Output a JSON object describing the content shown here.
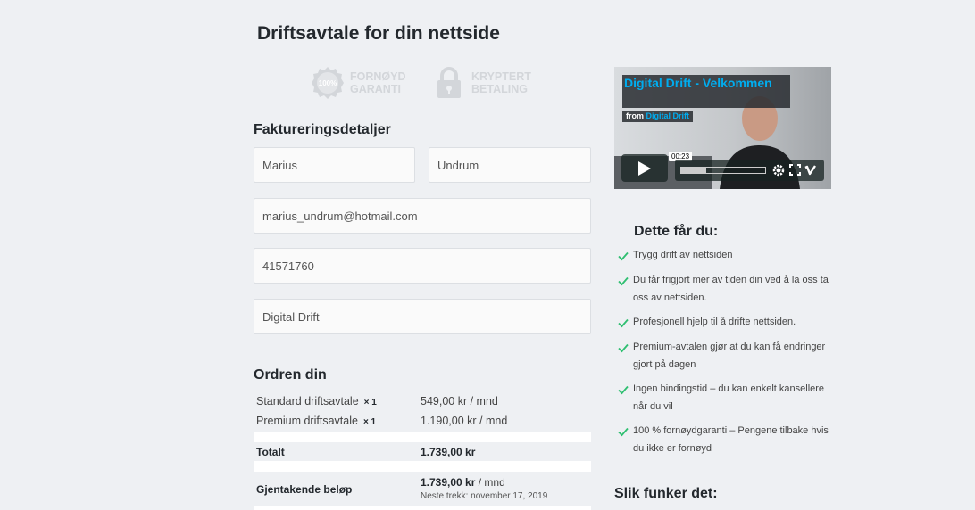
{
  "page": {
    "title": "Driftsavtale for din nettside"
  },
  "badges": [
    {
      "icon": "guarantee-seal-icon",
      "seal_text": "100%",
      "line1": "FORNØYD",
      "line2": "GARANTI"
    },
    {
      "icon": "lock-icon",
      "line1": "KRYPTERT",
      "line2": "BETALING"
    }
  ],
  "billing": {
    "heading": "Faktureringsdetaljer",
    "first_name": "Marius",
    "last_name": "Undrum",
    "email": "marius_undrum@hotmail.com",
    "phone": "41571760",
    "company": "Digital Drift"
  },
  "order": {
    "heading": "Ordren din",
    "items": [
      {
        "name": "Standard driftsavtale",
        "qty": "× 1",
        "price": "549,00 kr / mnd"
      },
      {
        "name": "Premium driftsavtale",
        "qty": "× 1",
        "price": "1.190,00 kr / mnd"
      }
    ],
    "total_label": "Totalt",
    "total_value": "1.739,00 kr",
    "recurring_label": "Gjentakende beløp",
    "recurring_amount": "1.739,00 kr",
    "recurring_unit": " / mnd",
    "next_charge": "Neste trekk: november 17, 2019"
  },
  "video": {
    "title": "Digital Drift - Velkommen",
    "from_label": "from ",
    "from_name": "Digital Drift",
    "time": "00:23",
    "progress": 0.3
  },
  "benefits": {
    "heading": "Dette får du:",
    "items": [
      "Trygg drift av nettsiden",
      "Du får frigjort mer av tiden din ved å la oss ta oss av nettsiden.",
      "Profesjonell hjelp til å drifte nettsiden.",
      "Premium-avtalen gjør at du kan få endringer gjort på dagen",
      "Ingen bindingstid – du kan enkelt kansellere når du vil",
      "100 % fornøydgaranti – Pengene tilbake hvis du ikke er fornøyd"
    ]
  },
  "how": {
    "heading": "Slik funker det:"
  },
  "colors": {
    "accent": "#00adef",
    "check": "#2fbf71",
    "background": "#eef0f3"
  }
}
